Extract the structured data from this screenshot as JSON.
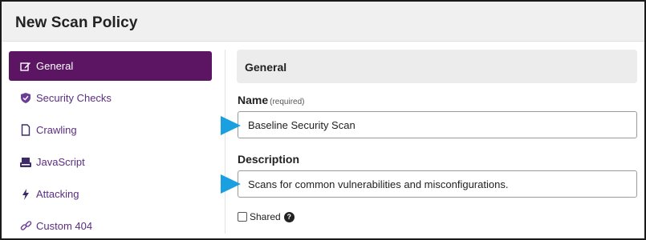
{
  "header": {
    "title": "New Scan Policy"
  },
  "sidebar": {
    "items": [
      {
        "label": "General",
        "icon": "edit-icon",
        "active": true
      },
      {
        "label": "Security Checks",
        "icon": "shield-check-icon",
        "active": false
      },
      {
        "label": "Crawling",
        "icon": "page-icon",
        "active": false
      },
      {
        "label": "JavaScript",
        "icon": "keyboard-icon",
        "active": false
      },
      {
        "label": "Attacking",
        "icon": "bolt-icon",
        "active": false
      },
      {
        "label": "Custom 404",
        "icon": "link-icon",
        "active": false
      }
    ]
  },
  "main": {
    "section_title": "General",
    "name": {
      "label": "Name",
      "required_note": "(required)",
      "value": "Baseline Security Scan"
    },
    "description": {
      "label": "Description",
      "value": "Scans for common vulnerabilities and misconfigurations."
    },
    "shared": {
      "label": "Shared",
      "checked": false,
      "help_glyph": "?"
    }
  },
  "colors": {
    "accent": "#5b1562",
    "nav_text": "#5a2d82",
    "arrow": "#1a9fe0",
    "header_bg": "#f0f0f0"
  }
}
